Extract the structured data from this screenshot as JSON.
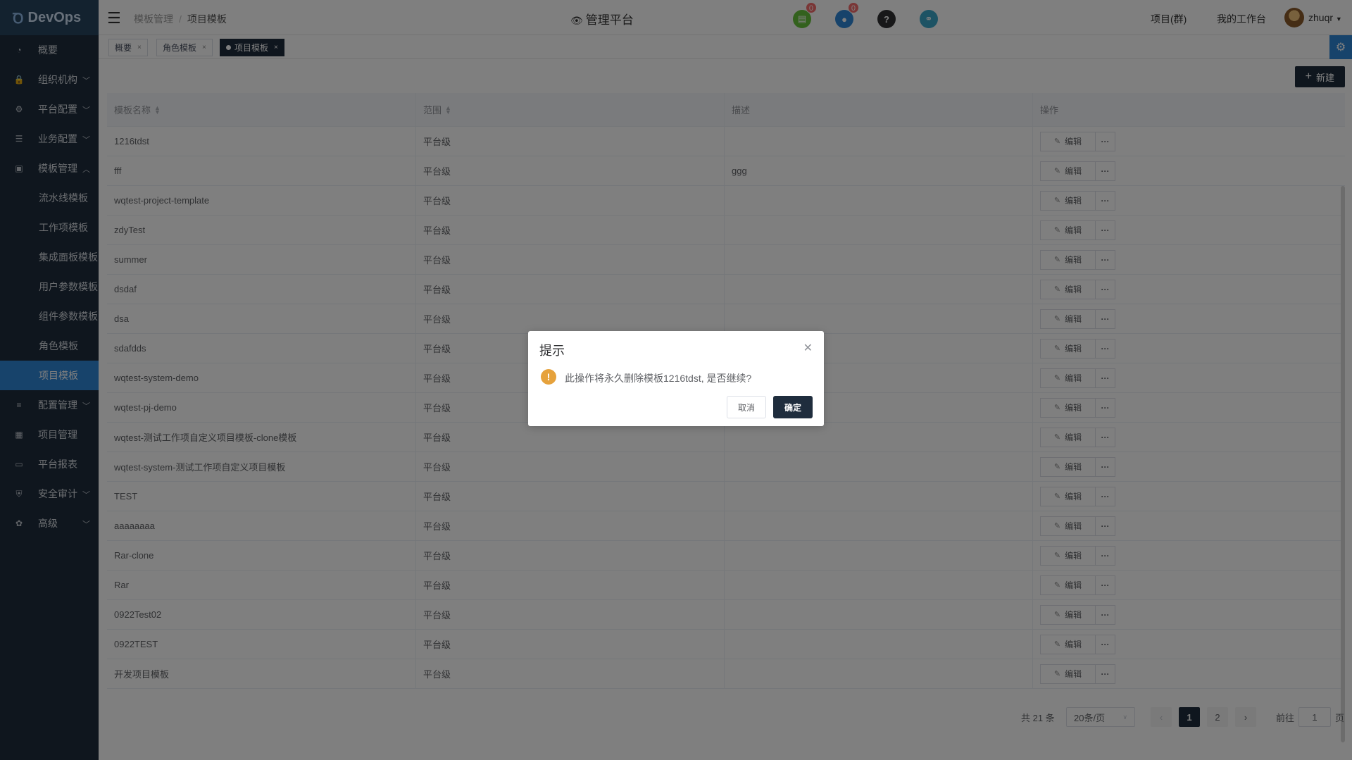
{
  "app": {
    "logo_text": "DevOps"
  },
  "sidebar": {
    "items": [
      {
        "label": "概要",
        "icon": "dashboard-icon",
        "has_chevron": false
      },
      {
        "label": "组织机构",
        "icon": "lock-icon",
        "has_chevron": true
      },
      {
        "label": "平台配置",
        "icon": "gear-icon",
        "has_chevron": true
      },
      {
        "label": "业务配置",
        "icon": "sliders-icon",
        "has_chevron": true
      },
      {
        "label": "模板管理",
        "icon": "template-icon",
        "has_chevron": true,
        "expanded": true
      }
    ],
    "sub_items": [
      {
        "label": "流水线模板"
      },
      {
        "label": "工作项模板"
      },
      {
        "label": "集成面板模板"
      },
      {
        "label": "用户参数模板"
      },
      {
        "label": "组件参数模板"
      },
      {
        "label": "角色模板"
      },
      {
        "label": "项目模板",
        "active": true
      }
    ],
    "items_after": [
      {
        "label": "配置管理",
        "icon": "database-icon",
        "has_chevron": true
      },
      {
        "label": "项目管理",
        "icon": "grid-icon",
        "has_chevron": false
      },
      {
        "label": "平台报表",
        "icon": "monitor-icon",
        "has_chevron": false
      },
      {
        "label": "安全审计",
        "icon": "shield-icon",
        "has_chevron": true
      },
      {
        "label": "高级",
        "icon": "palette-icon",
        "has_chevron": true
      }
    ]
  },
  "header": {
    "breadcrumb": [
      "模板管理",
      "项目模板"
    ],
    "title": "管理平台",
    "doc_badge": "0",
    "bell_badge": "0",
    "project_group_label": "项目(群)",
    "workspace_label": "我的工作台",
    "username": "zhuqr"
  },
  "tags": [
    {
      "label": "概要",
      "active": false
    },
    {
      "label": "角色模板",
      "active": false
    },
    {
      "label": "项目模板",
      "active": true
    }
  ],
  "toolbar": {
    "new_label": "新建"
  },
  "table": {
    "columns": [
      "模板名称",
      "范围",
      "描述",
      "操作"
    ],
    "edit_label": "编辑",
    "more_label": "···",
    "rows": [
      {
        "name": "1216tdst",
        "scope": "平台级",
        "desc": ""
      },
      {
        "name": "fff",
        "scope": "平台级",
        "desc": "ggg"
      },
      {
        "name": "wqtest-project-template",
        "scope": "平台级",
        "desc": ""
      },
      {
        "name": "zdyTest",
        "scope": "平台级",
        "desc": ""
      },
      {
        "name": "summer",
        "scope": "平台级",
        "desc": ""
      },
      {
        "name": "dsdaf",
        "scope": "平台级",
        "desc": ""
      },
      {
        "name": "dsa",
        "scope": "平台级",
        "desc": ""
      },
      {
        "name": "sdafdds",
        "scope": "平台级",
        "desc": ""
      },
      {
        "name": "wqtest-system-demo",
        "scope": "平台级",
        "desc": ""
      },
      {
        "name": "wqtest-pj-demo",
        "scope": "平台级",
        "desc": ""
      },
      {
        "name": "wqtest-测试工作项自定义项目模板-clone模板",
        "scope": "平台级",
        "desc": ""
      },
      {
        "name": "wqtest-system-测试工作项自定义项目模板",
        "scope": "平台级",
        "desc": ""
      },
      {
        "name": "TEST",
        "scope": "平台级",
        "desc": ""
      },
      {
        "name": "aaaaaaaa",
        "scope": "平台级",
        "desc": ""
      },
      {
        "name": "Rar-clone",
        "scope": "平台级",
        "desc": ""
      },
      {
        "name": "Rar",
        "scope": "平台级",
        "desc": ""
      },
      {
        "name": "0922Test02",
        "scope": "平台级",
        "desc": ""
      },
      {
        "name": "0922TEST",
        "scope": "平台级",
        "desc": ""
      },
      {
        "name": "开发项目模板",
        "scope": "平台级",
        "desc": ""
      }
    ]
  },
  "pagination": {
    "total": "共 21 条",
    "page_size": "20条/页",
    "pages": [
      "1",
      "2"
    ],
    "current": "1",
    "goto_label": "前往",
    "goto_value": "1",
    "page_suffix": "页"
  },
  "dialog": {
    "title": "提示",
    "message": "此操作将永久删除模板1216tdst, 是否继续?",
    "cancel": "取消",
    "confirm": "确定"
  },
  "colors": {
    "sidebar_bg": "#1f2d3d",
    "active_menu": "#2f86d6",
    "primary_button": "#1f2d3d",
    "warning": "#e6a23c"
  }
}
